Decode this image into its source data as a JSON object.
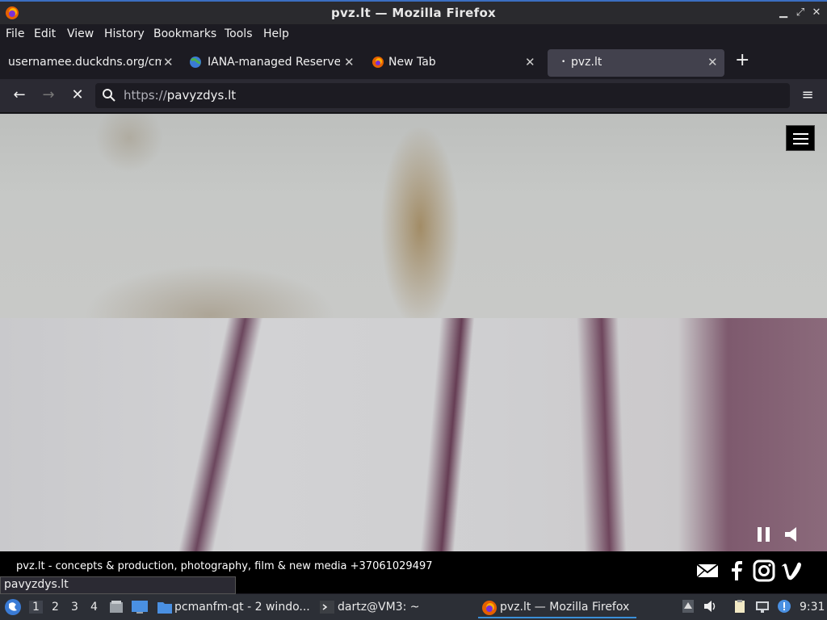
{
  "window": {
    "title": "pvz.lt — Mozilla Firefox"
  },
  "menu": {
    "items": [
      "File",
      "Edit",
      "View",
      "History",
      "Bookmarks",
      "Tools",
      "Help"
    ]
  },
  "tabs": [
    {
      "title": "usernamee.duckdns.org/cm",
      "active": false
    },
    {
      "title": "IANA-managed Reserved",
      "active": false
    },
    {
      "title": "New Tab",
      "active": false
    },
    {
      "title": "pvz.lt",
      "active": true
    }
  ],
  "nav": {
    "url_scheme": "https://",
    "url_host": "pavyzdys.lt"
  },
  "page": {
    "footer_text": "pvz.lt - concepts & production, photography, film & new media +37061029497",
    "social": [
      "mail-icon",
      "facebook-icon",
      "instagram-icon",
      "vimeo-icon"
    ]
  },
  "status": {
    "text": "pavyzdys.lt"
  },
  "taskbar": {
    "workspaces": [
      "1",
      "2",
      "3",
      "4"
    ],
    "tasks": [
      {
        "label": "pcmanfm-qt - 2 windo..."
      },
      {
        "label": "dartz@VM3: ~"
      },
      {
        "label": "pvz.lt — Mozilla Firefox"
      }
    ],
    "clock": "9:31"
  },
  "colors": {
    "accent": "#3b8fd9",
    "chrome": "#2b2a33",
    "tab_active": "#42414d"
  }
}
